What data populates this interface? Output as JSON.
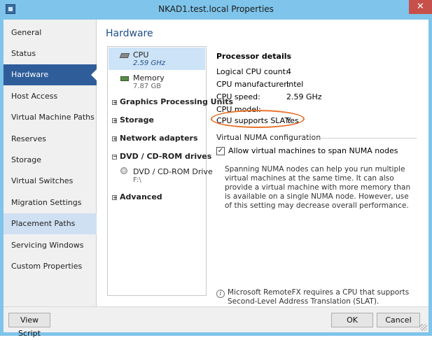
{
  "window": {
    "title": "NKAD1.test.local Properties",
    "close_glyph": "✕",
    "accent_color": "#7fc4ea"
  },
  "sidebar": {
    "items": [
      {
        "label": "General"
      },
      {
        "label": "Status"
      },
      {
        "label": "Hardware"
      },
      {
        "label": "Host Access"
      },
      {
        "label": "Virtual Machine Paths"
      },
      {
        "label": "Reserves"
      },
      {
        "label": "Storage"
      },
      {
        "label": "Virtual Switches"
      },
      {
        "label": "Migration Settings"
      },
      {
        "label": "Placement Paths"
      },
      {
        "label": "Servicing Windows"
      },
      {
        "label": "Custom Properties"
      }
    ],
    "selected": "Hardware",
    "selected_color": "#2e5d9a"
  },
  "main": {
    "heading": "Hardware",
    "tree": {
      "cpu_label": "CPU",
      "cpu_value": "2.59 GHz",
      "memory_label": "Memory",
      "memory_value": "7.87 GB",
      "gpu_group": "Graphics Processing Units",
      "storage_group": "Storage",
      "network_group": "Network adapters",
      "dvd_group": "DVD / CD-ROM drives",
      "dvd_label": "DVD / CD-ROM Drive",
      "dvd_value": "F:\\",
      "advanced_group": "Advanced",
      "expand_glyph": "+",
      "collapse_glyph": "−"
    },
    "processor": {
      "title": "Processor details",
      "rows": [
        {
          "label": "Logical CPU count:",
          "value": "4"
        },
        {
          "label": "CPU manufacturer:",
          "value": "Intel"
        },
        {
          "label": "CPU speed:",
          "value": "2.59 GHz"
        },
        {
          "label": "CPU model:",
          "value": ""
        },
        {
          "label": "CPU supports SLAT:",
          "value": "Yes"
        }
      ],
      "highlight_color": "#e8732c"
    },
    "numa": {
      "section_title": "Virtual NUMA configuration",
      "checkbox_label": "Allow virtual machines to span NUMA nodes",
      "checked": true,
      "check_glyph": "✓",
      "description": "Spanning NUMA nodes can help you run multiple virtual machines at the same time. It can also provide a virtual machine with more memory than is available on a single NUMA node. However, use of this setting may decrease overall performance."
    },
    "info": {
      "icon_glyph": "i",
      "text": "Microsoft RemoteFX requires a CPU that supports Second-Level Address Translation (SLAT)."
    }
  },
  "footer": {
    "view_script": "View Script",
    "ok": "OK",
    "cancel": "Cancel"
  }
}
